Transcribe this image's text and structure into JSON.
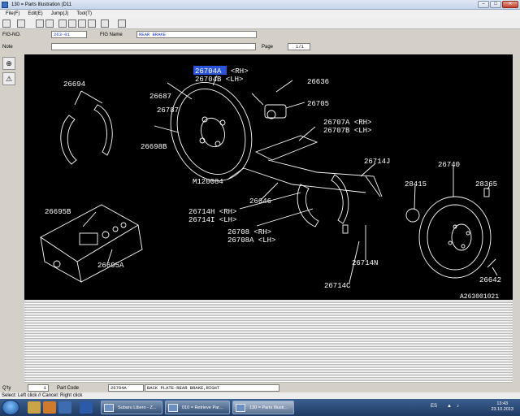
{
  "window": {
    "title": "130 = Parts Illustration (D11",
    "min": "–",
    "max": "□",
    "close": "✕"
  },
  "menu": [
    "File(F)",
    "Edit(E)",
    "Jump(J)",
    "Tool(T)"
  ],
  "fig": {
    "no_label": "FIG-NO.",
    "no_value": "263-01",
    "name_label": "FIG Name",
    "name_value": "REAR BRAKE",
    "note_label": "Note",
    "page_label": "Page",
    "page_value": "1/1"
  },
  "sidebar": {
    "zoom_glyph": "⊕",
    "warn_glyph": "⚠"
  },
  "diagram": {
    "labels": {
      "p26704a": "26704A",
      "lh_rh": "<RH>",
      "p26704b": "26704B <LH>",
      "p26694": "26694",
      "p26687": "26687",
      "p26787": "26787",
      "p26698b": "26698B",
      "p26636": "26636",
      "p26705": "26705",
      "p26707a": "26707A <RH>",
      "p26707b": "26707B <LH>",
      "p26714j": "26714J",
      "p26740": "26740",
      "p28415": "28415",
      "p28365": "28365",
      "m120084": "M120084",
      "p26646": "26646",
      "p26714h": "26714H <RH>",
      "p26714i": "26714I <LH>",
      "p26708": "26708 <RH>",
      "p26708a": "26708A <LH>",
      "p26695b": "26695B",
      "p26695a": "26695A",
      "p26714n": "26714N",
      "p26714c": "26714C",
      "p26642": "26642",
      "ref": "A263001021"
    }
  },
  "bottom": {
    "qty_label": "Q'ty",
    "qty_value": "1",
    "part_code_label": "Part Code",
    "part_code_value": "26704A",
    "desc_value": "BACK PLATE-REAR BRAKE,RIGHT"
  },
  "status": "Select: Left click // Cancel: Right click",
  "taskbar": {
    "start_glyph": "⊞",
    "tasks": [
      "Subaru Libero - Z...",
      "010 = Retrieve Par...",
      "130 = Parts Illustr..."
    ],
    "lang": "ES",
    "time": "13:43",
    "date": "23.10.2013"
  }
}
